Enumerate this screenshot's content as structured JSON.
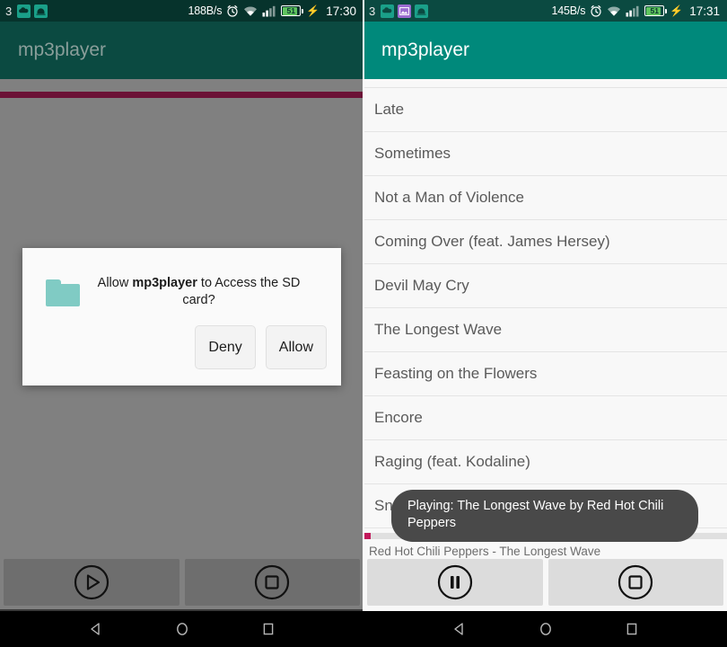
{
  "left_panel": {
    "status_bar": {
      "notification_count": "3",
      "icons": [
        "cloud-sync-icon",
        "android-update-icon"
      ],
      "network_speed": "188B/s",
      "alarm_icon": "alarm-icon",
      "wifi_icon": "wifi-icon",
      "signal_icon": "cellular-signal-icon",
      "battery_level": "51",
      "battery_charging_icon": "charging-bolt-icon",
      "time": "17:30"
    },
    "app_bar": {
      "title": "mp3player"
    },
    "dialog": {
      "icon": "folder-icon",
      "message_prefix": "Allow ",
      "message_app": "mp3player",
      "message_suffix": " to Access the SD card?",
      "deny_label": "Deny",
      "allow_label": "Allow"
    },
    "player": {
      "progress_percent": 100,
      "play_icon": "play-circle-icon",
      "stop_icon": "stop-circle-icon"
    },
    "nav_bar": {
      "back_icon": "back-triangle-icon",
      "home_icon": "home-circle-icon",
      "recents_icon": "recents-square-icon"
    }
  },
  "right_panel": {
    "status_bar": {
      "notification_count": "3",
      "icons": [
        "cloud-sync-icon",
        "screenshot-image-icon",
        "android-update-icon"
      ],
      "network_speed": "145B/s",
      "alarm_icon": "alarm-icon",
      "wifi_icon": "wifi-icon",
      "signal_icon": "cellular-signal-icon",
      "battery_level": "51",
      "battery_charging_icon": "charging-bolt-icon",
      "time": "17:31"
    },
    "app_bar": {
      "title": "mp3player"
    },
    "song_list": [
      {
        "title": "Late"
      },
      {
        "title": "Sometimes"
      },
      {
        "title": "Not a Man of Violence"
      },
      {
        "title": "Coming Over (feat. James Hersey)"
      },
      {
        "title": "Devil May Cry"
      },
      {
        "title": "The Longest Wave"
      },
      {
        "title": "Feasting on the Flowers"
      },
      {
        "title": "Encore"
      },
      {
        "title": "Raging (feat. Kodaline)"
      },
      {
        "title": "Snow"
      }
    ],
    "toast": {
      "message": "Playing: The Longest Wave by Red Hot Chili Peppers"
    },
    "player": {
      "now_playing": "Red Hot Chili Peppers - The Longest Wave",
      "progress_percent": 2,
      "pause_icon": "pause-circle-icon",
      "stop_icon": "stop-circle-icon"
    },
    "nav_bar": {
      "back_icon": "back-triangle-icon",
      "home_icon": "home-circle-icon",
      "recents_icon": "recents-square-icon"
    }
  },
  "colors": {
    "status_bar_left": "#06332c",
    "status_bar_right": "#0b4a41",
    "app_bar_left": "#0b4a41",
    "app_bar_right": "#00897b",
    "scrim": "#808080",
    "progress_accent": "#c2185b",
    "folder_teal": "#80cbc4",
    "toast_background": "#494949",
    "battery_green": "#5ec45e"
  }
}
